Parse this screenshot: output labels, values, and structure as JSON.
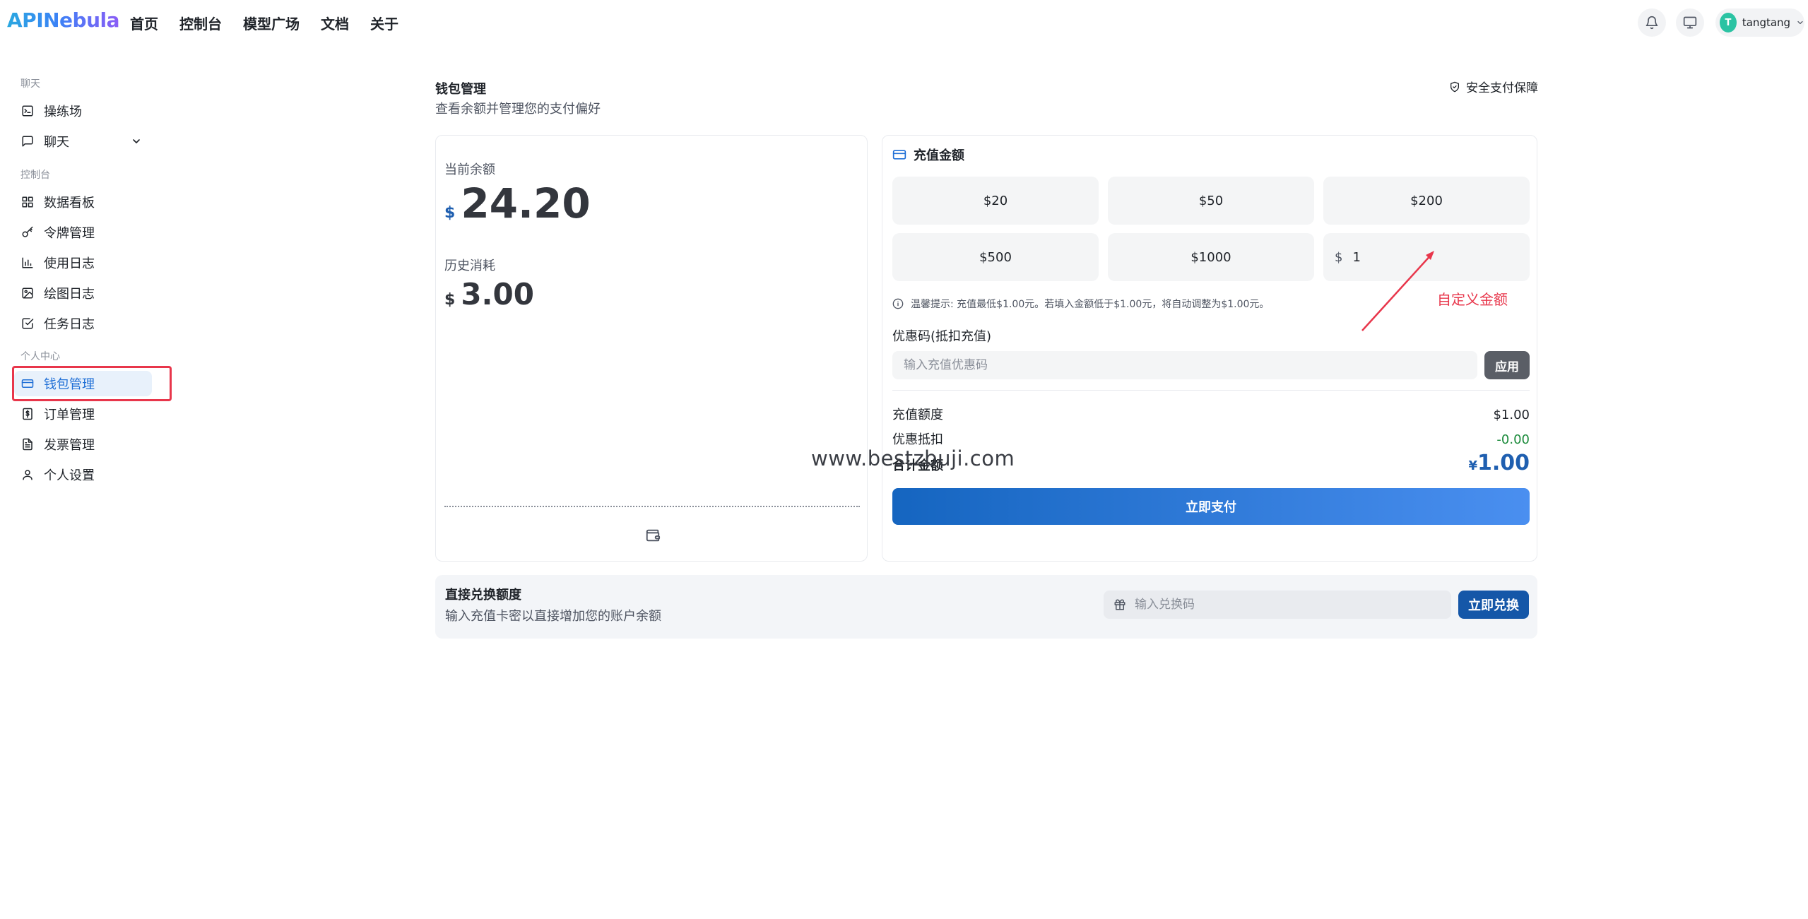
{
  "app": {
    "logo": "APINebula",
    "user_initial": "T",
    "username": "tangtang"
  },
  "nav": [
    {
      "label": "首页"
    },
    {
      "label": "控制台"
    },
    {
      "label": "模型广场"
    },
    {
      "label": "文档"
    },
    {
      "label": "关于"
    }
  ],
  "sidebar": {
    "group_chat": "聊天",
    "group_console": "控制台",
    "group_personal": "个人中心",
    "items": [
      {
        "label": "操练场",
        "icon": "playground-icon"
      },
      {
        "label": "聊天",
        "icon": "chat-icon"
      },
      {
        "label": "数据看板",
        "icon": "dashboard-icon"
      },
      {
        "label": "令牌管理",
        "icon": "key-icon"
      },
      {
        "label": "使用日志",
        "icon": "bar-chart-icon"
      },
      {
        "label": "绘图日志",
        "icon": "image-icon"
      },
      {
        "label": "任务日志",
        "icon": "checkbox-icon"
      },
      {
        "label": "钱包管理",
        "icon": "wallet-card-icon"
      },
      {
        "label": "订单管理",
        "icon": "dollar-doc-icon"
      },
      {
        "label": "发票管理",
        "icon": "invoice-icon"
      },
      {
        "label": "个人设置",
        "icon": "user-icon"
      }
    ]
  },
  "page": {
    "title": "钱包管理",
    "subtitle": "查看余额并管理您的支付偏好",
    "secure_label": "安全支付保障"
  },
  "balance": {
    "current_label": "当前余额",
    "currency": "$",
    "current_value": "24.20",
    "history_label": "历史消耗",
    "history_value": "3.00"
  },
  "recharge": {
    "title": "充值金额",
    "amounts": [
      "$20",
      "$50",
      "$200",
      "$500",
      "$1000"
    ],
    "custom_currency": "$",
    "custom_value": "1",
    "tip": "温馨提示: 充值最低$1.00元。若填入金额低于$1.00元，将自动调整为$1.00元。",
    "coupon_label": "优惠码(抵扣充值)",
    "coupon_placeholder": "输入充值优惠码",
    "apply_label": "应用",
    "amount_label": "充值额度",
    "amount_value": "$1.00",
    "discount_label": "优惠抵扣",
    "discount_value": "-0.00",
    "total_label": "合计金额",
    "total_currency": "¥",
    "total_value": "1.00",
    "pay_label": "立即支付"
  },
  "annotation": {
    "label": "自定义金额",
    "color": "#e8364b"
  },
  "watermark": "www.bestzbuji.com",
  "redeem": {
    "title": "直接兑换额度",
    "subtitle": "输入充值卡密以直接增加您的账户余额",
    "placeholder": "输入兑换码",
    "button_label": "立即兑换"
  },
  "colors": {
    "accent": "#1f5fb0",
    "active_bg": "#e8f1fb",
    "discount": "#1a8a3a"
  }
}
